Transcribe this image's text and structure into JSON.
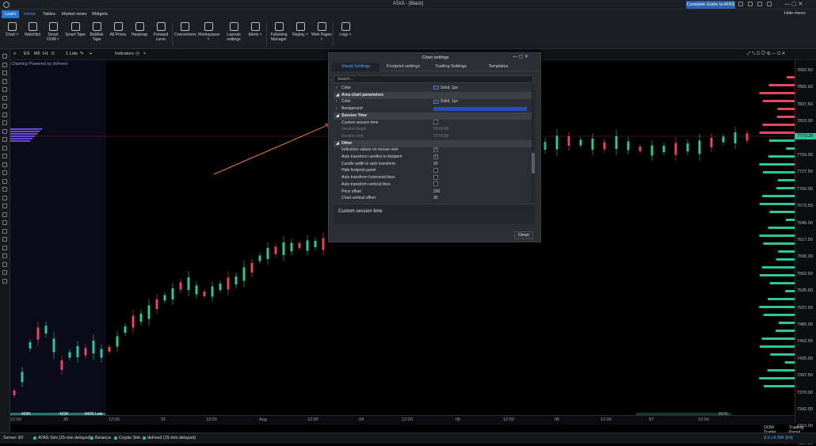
{
  "app": {
    "title": "ATAS - [Black]",
    "guide_button": "Complete Guide to ATAS",
    "hide_menu": "Hide menu"
  },
  "menu": [
    {
      "label": "Learn"
    },
    {
      "label": "Home"
    },
    {
      "label": "Tables"
    },
    {
      "label": "Market news"
    },
    {
      "label": "Widgets"
    }
  ],
  "ribbon": [
    {
      "label": "Chart ˅"
    },
    {
      "label": "Watchlist"
    },
    {
      "label": "Smart DOM ˅"
    },
    {
      "label": "Smart Tape"
    },
    {
      "label": "Bid/Ask Tape"
    },
    {
      "label": "All Prices"
    },
    {
      "label": "Heatmap"
    },
    {
      "label": "Forward curve"
    },
    {
      "label": "Connections"
    },
    {
      "label": "Workspaces ˅"
    },
    {
      "label": "Layouts settings"
    },
    {
      "label": "Alerts ˅"
    },
    {
      "label": "Following Manager"
    },
    {
      "label": "Replay ˅"
    },
    {
      "label": "Web Pages ˅"
    },
    {
      "label": "Logs ˅"
    }
  ],
  "chart_toolbar": {
    "symbol": "ES",
    "tf1": "M5",
    "tf2": "H1",
    "tf3": "D",
    "lots": "1 Lots",
    "indicators": "Indicators"
  },
  "chart": {
    "powered": "Charting Powered by dxFeed",
    "current_price": "7773.25"
  },
  "price_labels": [
    "7892.50",
    "7865.00",
    "7837.50",
    "7810.00",
    "7782.50",
    "7755.00",
    "7727.50",
    "7700.00",
    "7672.50",
    "7645.00",
    "7617.50",
    "7590.00",
    "7562.50",
    "7535.00",
    "7507.50",
    "7480.00",
    "7452.50",
    "7425.00",
    "7397.50",
    "7370.00",
    "7342.50",
    "7315.00",
    "7287.50"
  ],
  "time_labels": [
    "12:00",
    "30",
    "12:00",
    "31",
    "12:00",
    "Aug",
    "12:00",
    "04",
    "12:00",
    "05",
    "12:00",
    "06",
    "12:00",
    "07",
    "12:00"
  ],
  "volume_labels": [
    "429K",
    "423K",
    "842K Lots"
  ],
  "volume_right": "667K",
  "dialog": {
    "title": "Chart settings",
    "tabs": [
      "Visual Settings",
      "Footprint settings",
      "Trading Settings",
      "Templates"
    ],
    "search_placeholder": "Search...",
    "rows": [
      {
        "type": "prop",
        "key": "Color",
        "value": "Solid; 1px",
        "swatch": true,
        "arrow": "›"
      },
      {
        "type": "sec",
        "key": "Area chart parameters",
        "arrow": "◢"
      },
      {
        "type": "prop",
        "key": "Color",
        "value": "Solid; 1px",
        "swatch": true,
        "arrow": "›"
      },
      {
        "type": "prop",
        "key": "Background",
        "value": "",
        "bar": true,
        "arrow": "›"
      },
      {
        "type": "sec",
        "key": "Session Time",
        "arrow": "◢"
      },
      {
        "type": "check",
        "key": "Custom session time",
        "checked": false
      },
      {
        "type": "dis",
        "key": "Session begin",
        "value": "00:00:00"
      },
      {
        "type": "dis",
        "key": "Session end",
        "value": "23:59:59"
      },
      {
        "type": "sec",
        "key": "Other",
        "arrow": "◢"
      },
      {
        "type": "check",
        "key": "Indicators values on mouse over",
        "checked": true
      },
      {
        "type": "check",
        "key": "Auto transform candles to footprint",
        "checked": true
      },
      {
        "type": "prop",
        "key": "Candle width to auto transform",
        "value": "20"
      },
      {
        "type": "check",
        "key": "Hide footprint panel",
        "checked": false
      },
      {
        "type": "check",
        "key": "Auto transform horizontal lines",
        "checked": false
      },
      {
        "type": "check",
        "key": "Auto transform vertical lines",
        "checked": false
      },
      {
        "type": "prop",
        "key": "Price offset",
        "value": "200"
      },
      {
        "type": "prop",
        "key": "Chart vertical offset",
        "value": "30"
      }
    ],
    "description": "Custom session time",
    "close": "Close"
  },
  "status": {
    "server": "Server: 82",
    "items": [
      "ATAS Sim (15-min delayed)",
      "Binance",
      "Crypto Sim",
      "dxFeed (15-min delayed)"
    ]
  },
  "bottom_tabs": [
    "DOM Trader",
    "Trading Panel"
  ],
  "bottom_right": "8.0.14.986 [64]",
  "colors": {
    "accent": "#2478d4",
    "bull": "#2fc59c",
    "bear": "#e8455e",
    "arrow": "#e87d3e"
  }
}
